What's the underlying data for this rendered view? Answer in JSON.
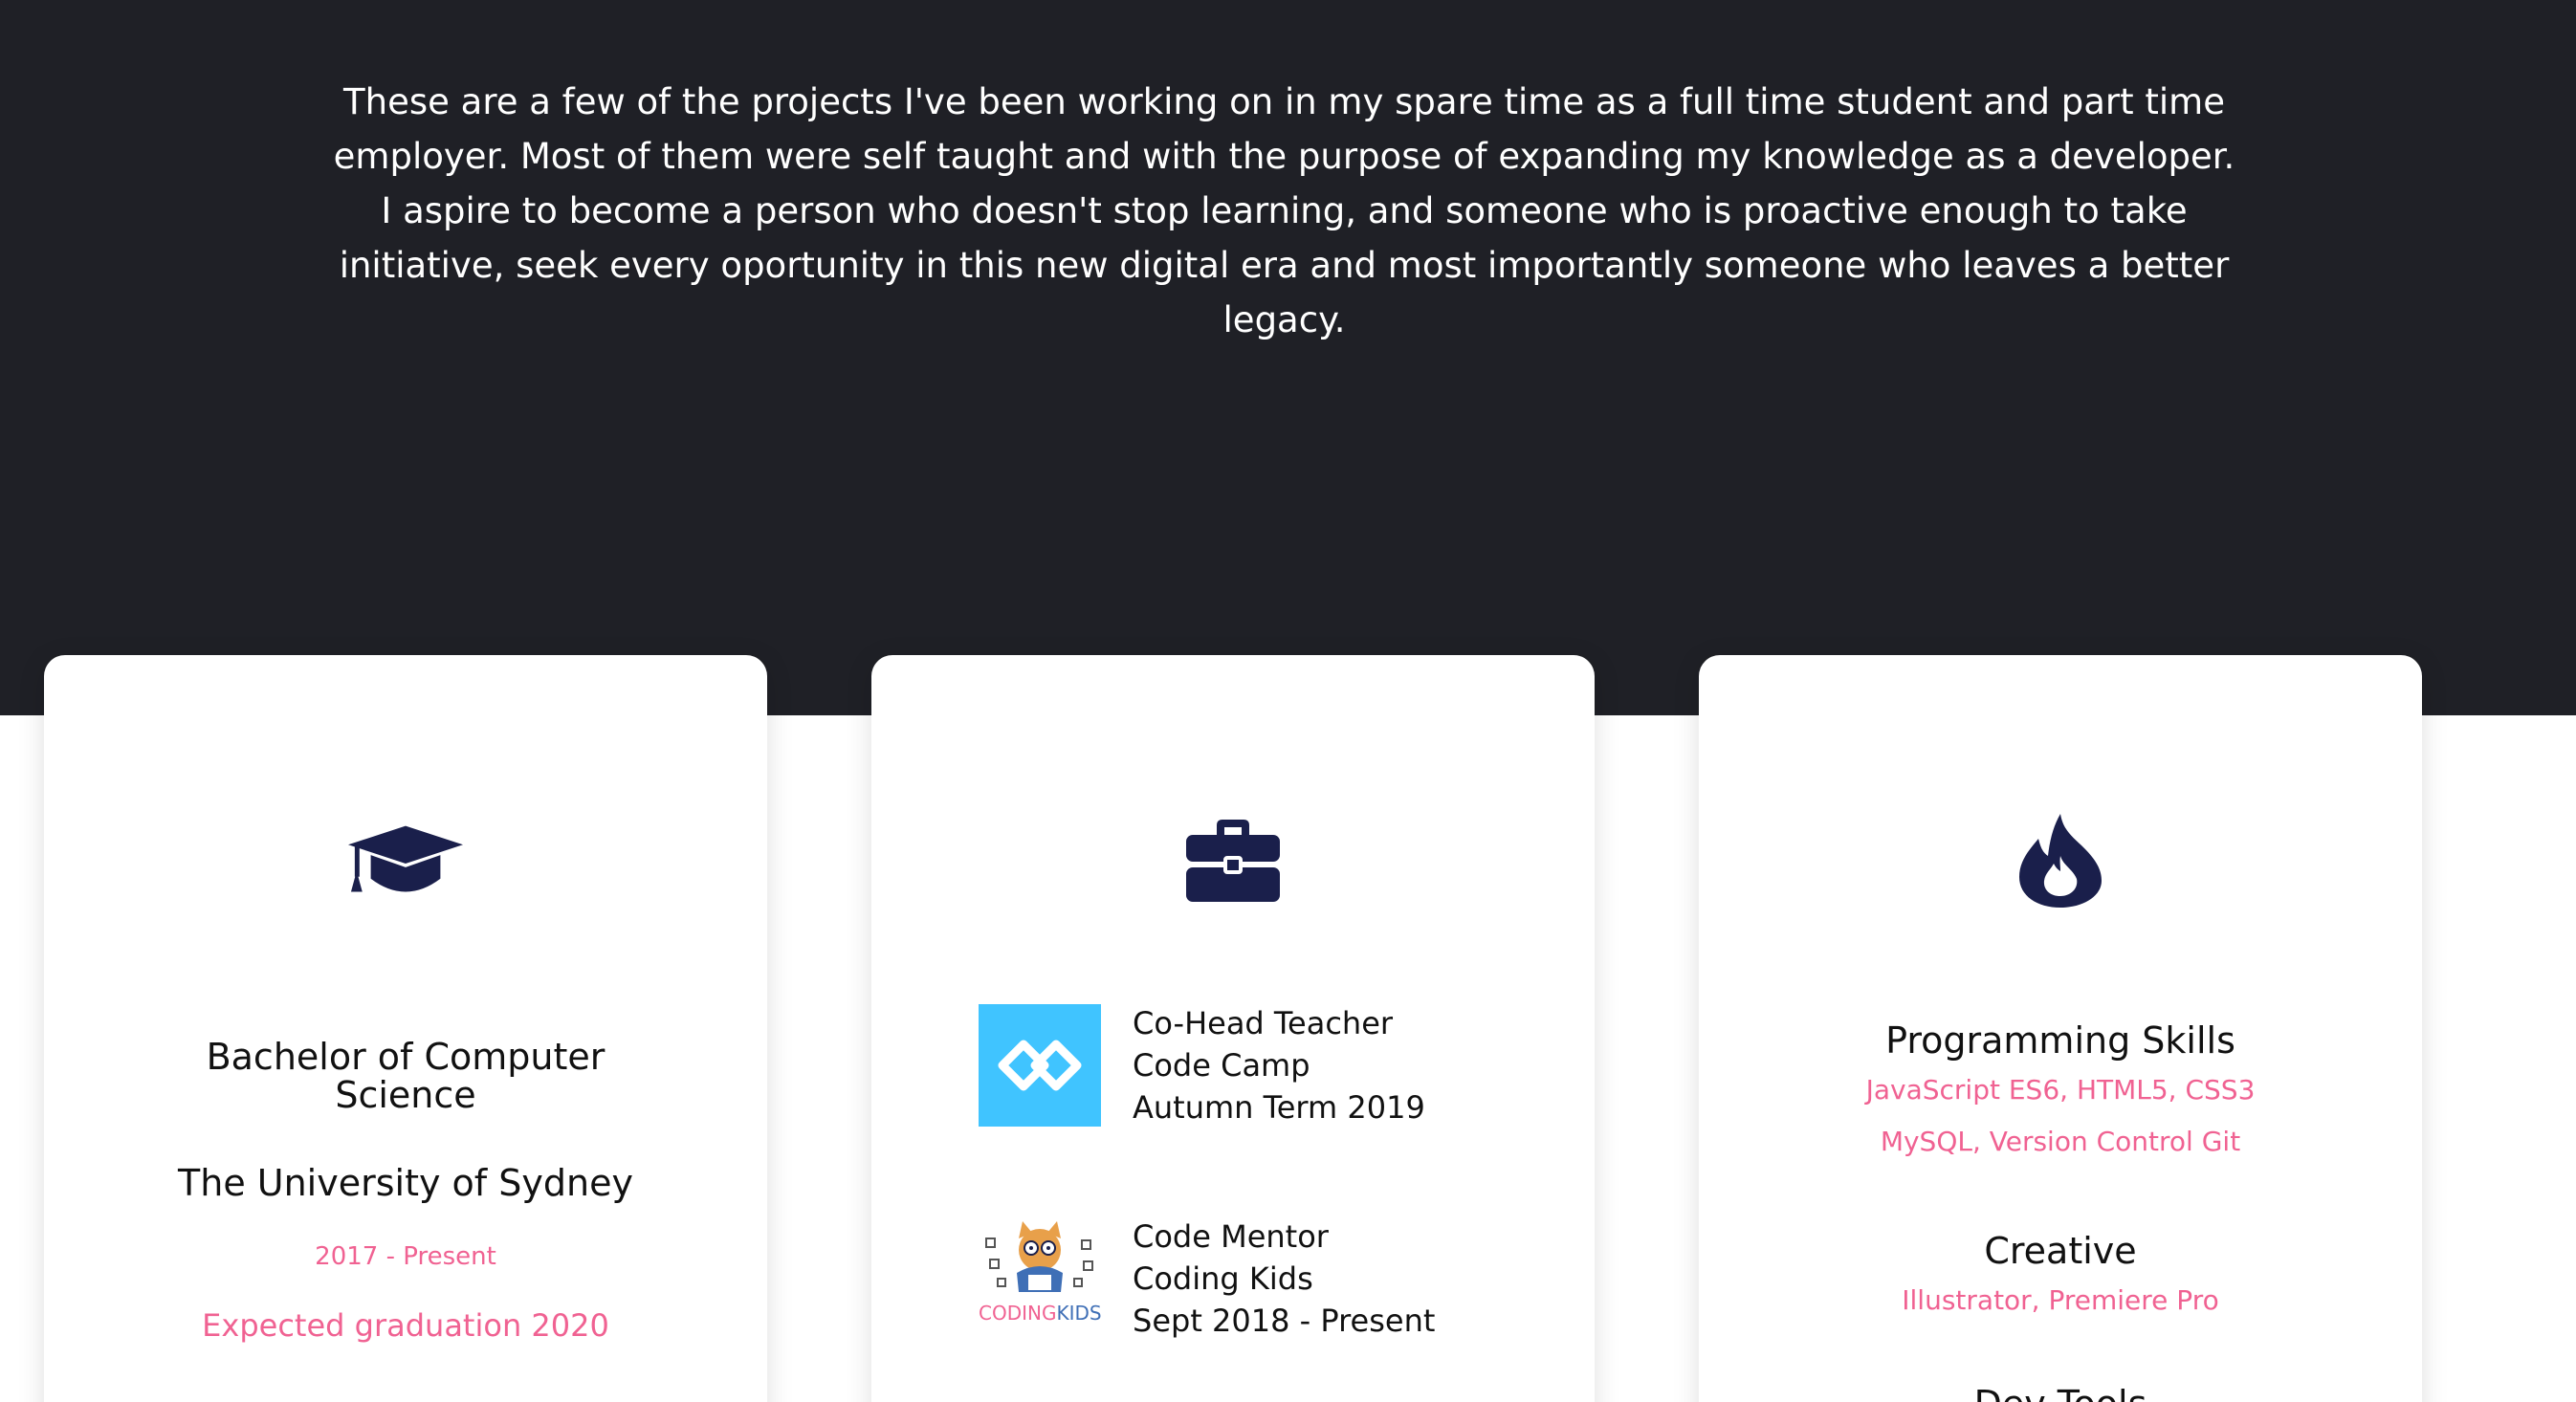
{
  "hero": {
    "intro_line_1": "These are a few of the projects I've been working on in my spare time as a full time student and part time",
    "intro_line_2": "employer. Most of them were self taught and with the purpose of expanding my knowledge as a developer.",
    "intro_line_3": "I aspire to become a person who doesn't stop learning, and someone who is proactive enough to take",
    "intro_line_4": "initiative, seek every oportunity in this new digital era and most importantly someone who leaves a better",
    "intro_line_5": "legacy."
  },
  "education": {
    "icon": "graduation-cap-icon",
    "degree_line_1": "Bachelor of Computer",
    "degree_line_2": "Science",
    "school": "The University of Sydney",
    "years": "2017 - Present",
    "graduation": "Expected graduation 2020"
  },
  "experience": {
    "icon": "briefcase-icon",
    "jobs": [
      {
        "logo": "code-camp-logo",
        "role": "Co-Head Teacher",
        "company": "Code Camp",
        "period": "Autumn Term 2019"
      },
      {
        "logo": "coding-kids-logo",
        "logo_text": "CODINGKIDS",
        "role": "Code Mentor",
        "company": "Coding Kids",
        "period": "Sept 2018 - Present"
      }
    ]
  },
  "skills": {
    "icon": "flame-icon",
    "groups": [
      {
        "title": "Programming Skills",
        "details": [
          "JavaScript ES6, HTML5, CSS3",
          "MySQL, Version Control Git"
        ]
      },
      {
        "title": "Creative",
        "details": [
          "Illustrator, Premiere Pro"
        ]
      },
      {
        "title": "Dev Tools",
        "details": []
      }
    ]
  },
  "colors": {
    "hero_background": "#1f2026",
    "icon_navy": "#1a1f4b",
    "accent_pink": "#f06292",
    "code_camp_blue": "#40c4ff"
  }
}
